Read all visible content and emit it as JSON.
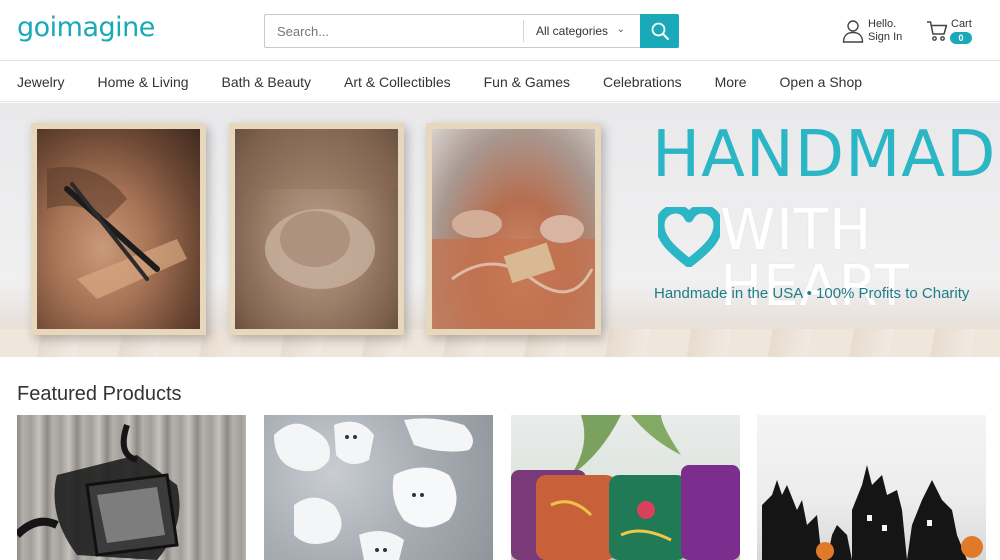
{
  "header": {
    "logo_text": "goimagine",
    "search_placeholder": "Search...",
    "category_selected": "All categories",
    "account_line1": "Hello.",
    "account_line2": "Sign In",
    "cart_label": "Cart",
    "cart_count": "0"
  },
  "nav": {
    "items": [
      {
        "label": "Jewelry"
      },
      {
        "label": "Home & Living"
      },
      {
        "label": "Bath & Beauty"
      },
      {
        "label": "Art & Collectibles"
      },
      {
        "label": "Fun & Games"
      },
      {
        "label": "Celebrations"
      },
      {
        "label": "More"
      },
      {
        "label": "Open a Shop"
      }
    ]
  },
  "hero": {
    "title": "HANDMADE",
    "subtitle": "WITH HEART",
    "tagline": "Handmade in the USA • 100% Profits to Charity"
  },
  "featured": {
    "title": "Featured Products"
  },
  "colors": {
    "brand": "#1aa9b8",
    "hero_title": "#2ab6c4",
    "tagline": "#1d7c8a"
  },
  "icons": {
    "search": "search-icon",
    "account": "user-icon",
    "cart": "cart-icon",
    "dropdown": "chevron-down-icon"
  }
}
